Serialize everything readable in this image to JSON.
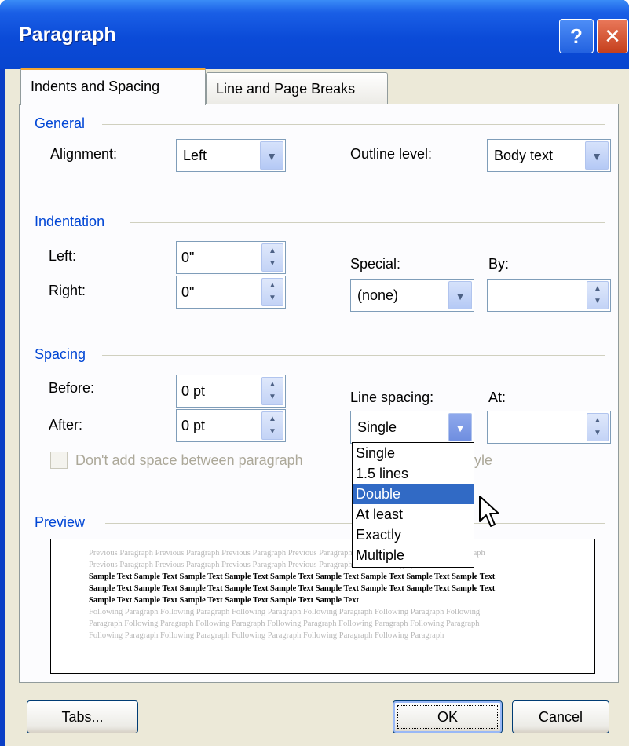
{
  "window": {
    "title": "Paragraph",
    "help_label": "?",
    "close_label": "✕",
    "title_bar_color": "#0b4bd8"
  },
  "tabs": [
    {
      "label": "Indents and Spacing",
      "active": true
    },
    {
      "label": "Line and Page Breaks",
      "active": false
    }
  ],
  "general": {
    "section_label": "General",
    "alignment_label": "Alignment:",
    "alignment_value": "Left",
    "outline_label": "Outline level:",
    "outline_value": "Body text"
  },
  "indentation": {
    "section_label": "Indentation",
    "left_label": "Left:",
    "left_value": "0\"",
    "right_label": "Right:",
    "right_value": "0\"",
    "special_label": "Special:",
    "special_value": "(none)",
    "by_label": "By:",
    "by_value": ""
  },
  "spacing": {
    "section_label": "Spacing",
    "before_label": "Before:",
    "before_value": "0 pt",
    "after_label": "After:",
    "after_value": "0 pt",
    "line_spacing_label": "Line spacing:",
    "line_spacing_value": "Single",
    "at_label": "At:",
    "at_value": "",
    "dont_add_space_label": "Don't add space between paragraph",
    "dont_add_space_tail": "yle",
    "dont_add_space_checked": false
  },
  "line_spacing_options": [
    "Single",
    "1.5 lines",
    "Double",
    "At least",
    "Exactly",
    "Multiple"
  ],
  "line_spacing_highlighted": "Double",
  "preview": {
    "section_label": "Preview",
    "previous_paragraph": "Previous Paragraph Previous Paragraph Previous Paragraph Previous Paragraph Previous Paragraph Previous Paragraph Previous Paragraph Previous Paragraph Previous Paragraph Previous Paragraph Previous Paragraph",
    "sample_text": "Sample Text Sample Text Sample Text Sample Text Sample Text Sample Text Sample Text Sample Text Sample Text Sample Text Sample Text Sample Text Sample Text Sample Text Sample Text Sample Text Sample Text Sample Text Sample Text Sample Text Sample Text Sample Text Sample Text Sample Text",
    "following_paragraph": "Following Paragraph Following Paragraph Following Paragraph Following Paragraph Following Paragraph Following Paragraph Following Paragraph Following Paragraph Following Paragraph Following Paragraph Following Paragraph Following Paragraph Following Paragraph Following Paragraph Following Paragraph Following Paragraph"
  },
  "buttons": {
    "tabs_label": "Tabs...",
    "ok_label": "OK",
    "cancel_label": "Cancel"
  }
}
